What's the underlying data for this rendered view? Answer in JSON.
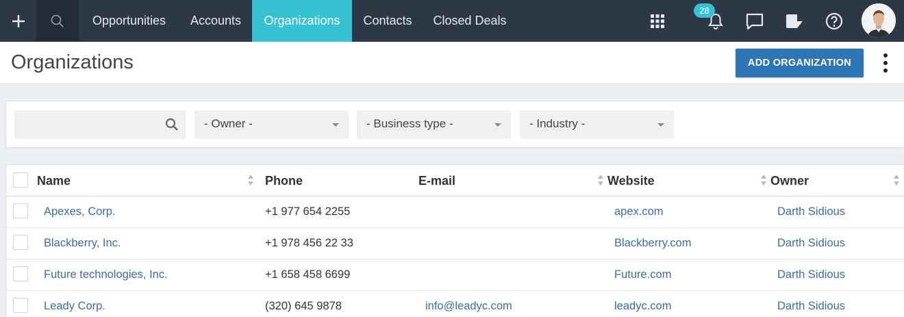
{
  "nav": {
    "items": [
      {
        "label": "Opportunities",
        "active": false
      },
      {
        "label": "Accounts",
        "active": false
      },
      {
        "label": "Organizations",
        "active": true
      },
      {
        "label": "Contacts",
        "active": false
      },
      {
        "label": "Closed Deals",
        "active": false
      }
    ],
    "notification_count": "28",
    "icons": [
      "plus-icon",
      "search-icon",
      "apps-grid-icon",
      "bell-icon",
      "chat-icon",
      "tag-icon",
      "help-icon"
    ]
  },
  "header": {
    "title": "Organizations",
    "add_button": "ADD ORGANIZATION"
  },
  "filters": {
    "search_value": "",
    "owner": "- Owner -",
    "business_type": "- Business type -",
    "industry": "- Industry -"
  },
  "table": {
    "columns": [
      "Name",
      "Phone",
      "E-mail",
      "Website",
      "Owner"
    ],
    "rows": [
      {
        "name": "Apexes, Corp.",
        "phone": "+1 977 654 2255",
        "email": "",
        "website": "apex.com",
        "owner": "Darth Sidious"
      },
      {
        "name": "Blackberry, Inc.",
        "phone": "+1 978 456 22 33",
        "email": "",
        "website": "Blackberry.com",
        "owner": "Darth Sidious"
      },
      {
        "name": "Future technologies, Inc.",
        "phone": "+1 658 458 6699",
        "email": "",
        "website": "Future.com",
        "owner": "Darth Sidious"
      },
      {
        "name": "Leady Corp.",
        "phone": "(320) 645 9878",
        "email": "info@leadyc.com",
        "website": "leadyc.com",
        "owner": "Darth Sidious"
      }
    ]
  },
  "colors": {
    "nav_bg": "#2c3845",
    "accent": "#35c2d3",
    "primary_button": "#2e75b5",
    "link": "#3a6ea5"
  }
}
